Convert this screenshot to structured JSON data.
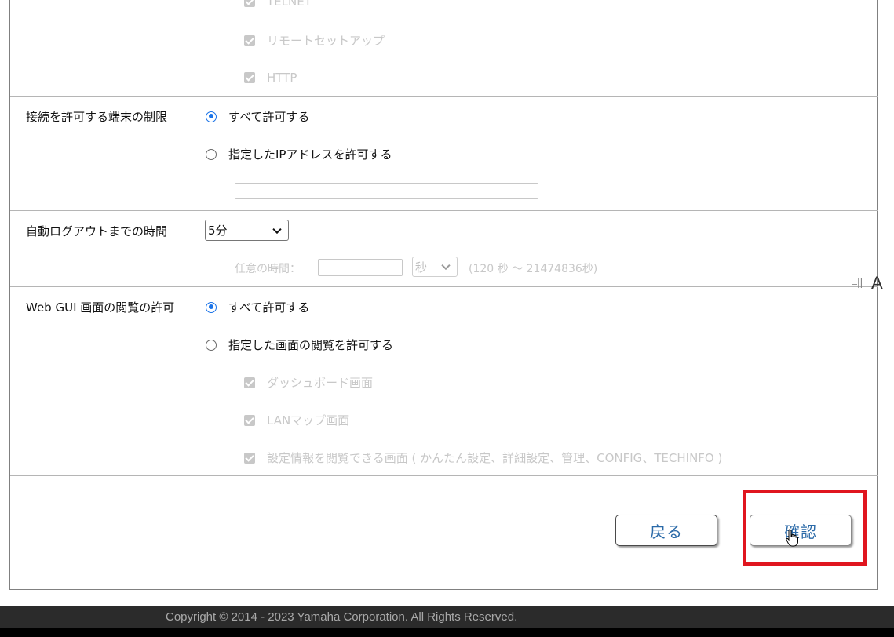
{
  "top_options": {
    "telnet": "TELNET",
    "remote_setup": "リモートセットアップ",
    "http": "HTTP"
  },
  "access_restriction": {
    "label": "接続を許可する端末の制限",
    "allow_all": "すべて許可する",
    "allow_ip": "指定したIPアドレスを許可する",
    "ip_value": ""
  },
  "auto_logout": {
    "label": "自動ログアウトまでの時間",
    "selected": "5分",
    "custom_label": "任意の時間：",
    "custom_value": "",
    "unit": "秒",
    "range_hint": "(120 秒 ～ 21474836秒)"
  },
  "gui_view": {
    "label": "Web GUI 画面の閲覧の許可",
    "allow_all": "すべて許可する",
    "allow_specified": "指定した画面の閲覧を許可する",
    "dashboard": "ダッシュボード画面",
    "lan_map": "LANマップ画面",
    "settings": "設定情報を閲覧できる画面 ( かんたん設定、詳細設定、管理、CONFIG、TECHINFO )"
  },
  "buttons": {
    "back": "戻る",
    "confirm": "確認"
  },
  "side_widget": {
    "bars": "||",
    "letter": "A"
  },
  "footer": {
    "copyright": "Copyright © 2014 - 2023 Yamaha Corporation. All Rights Reserved."
  },
  "colors": {
    "accent": "#1a73e8",
    "button_text": "#2b6aa8",
    "highlight": "#e0161f",
    "footer_bg": "#2b2b2b"
  }
}
